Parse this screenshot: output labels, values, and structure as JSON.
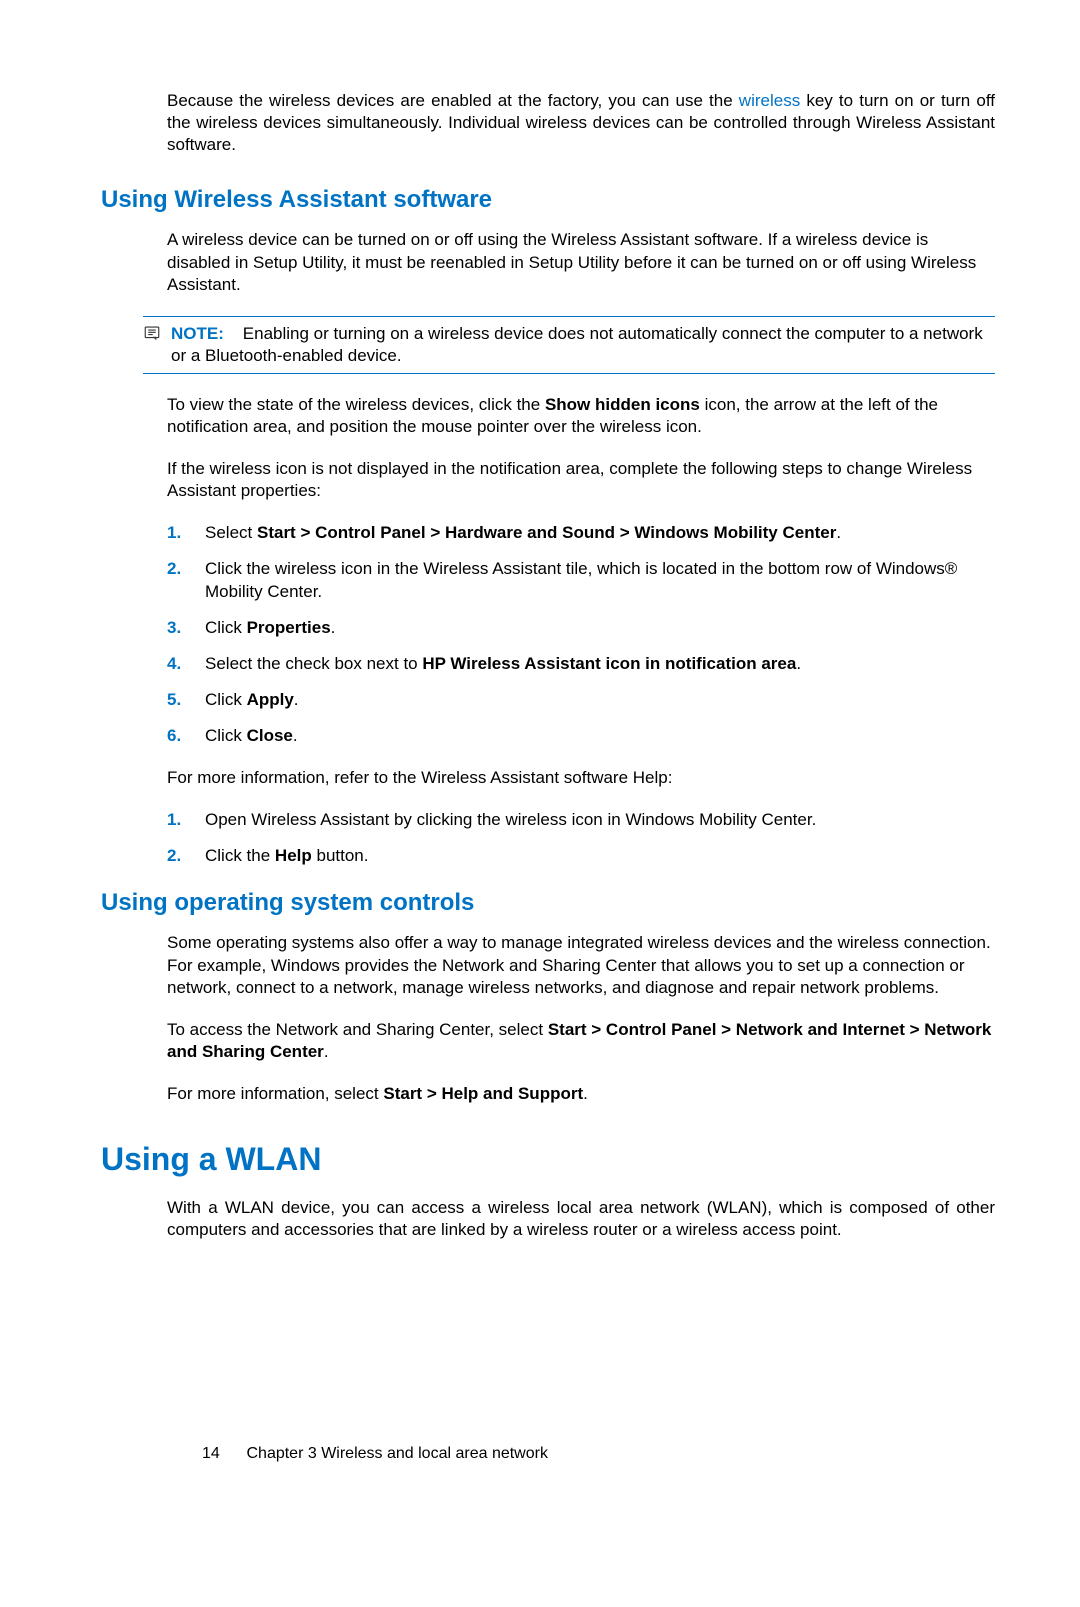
{
  "intro": {
    "prefix": "Because the wireless devices are enabled at the factory, you can use the ",
    "link": "wireless",
    "suffix": " key to turn on or turn off the wireless devices simultaneously. Individual wireless devices can be controlled through Wireless Assistant software."
  },
  "section1": {
    "heading": "Using Wireless Assistant software",
    "p1": "A wireless device can be turned on or off using the Wireless Assistant software. If a wireless device is disabled in Setup Utility, it must be reenabled in Setup Utility before it can be turned on or off using Wireless Assistant.",
    "note": {
      "label": "NOTE:",
      "text": "Enabling or turning on a wireless device does not automatically connect the computer to a network or a Bluetooth-enabled device."
    },
    "p2_pre": "To view the state of the wireless devices, click the ",
    "p2_bold": "Show hidden icons",
    "p2_post": " icon, the arrow at the left of the notification area, and position the mouse pointer over the wireless icon.",
    "p3": "If the wireless icon is not displayed in the notification area, complete the following steps to change Wireless Assistant properties:",
    "list1": {
      "i1_pre": "Select ",
      "i1_bold": "Start > Control Panel > Hardware and Sound > Windows Mobility Center",
      "i1_post": ".",
      "i2": "Click the wireless icon in the Wireless Assistant tile, which is located in the bottom row of Windows® Mobility Center.",
      "i3_pre": "Click ",
      "i3_bold": "Properties",
      "i3_post": ".",
      "i4_pre": "Select the check box next to ",
      "i4_bold": "HP Wireless Assistant icon in notification area",
      "i4_post": ".",
      "i5_pre": "Click ",
      "i5_bold": "Apply",
      "i5_post": ".",
      "i6_pre": "Click ",
      "i6_bold": "Close",
      "i6_post": "."
    },
    "p4": "For more information, refer to the Wireless Assistant software Help:",
    "list2": {
      "i1": "Open Wireless Assistant by clicking the wireless icon in Windows Mobility Center.",
      "i2_pre": "Click the ",
      "i2_bold": "Help",
      "i2_post": " button."
    }
  },
  "section2": {
    "heading": "Using operating system controls",
    "p1": "Some operating systems also offer a way to manage integrated wireless devices and the wireless connection. For example, Windows provides the Network and Sharing Center that allows you to set up a connection or network, connect to a network, manage wireless networks, and diagnose and repair network problems.",
    "p2_pre": "To access the Network and Sharing Center, select ",
    "p2_bold": "Start > Control Panel > Network and Internet > Network and Sharing Center",
    "p2_post": ".",
    "p3_pre": "For more information, select ",
    "p3_bold": "Start > Help and Support",
    "p3_post": "."
  },
  "section3": {
    "heading": "Using a WLAN",
    "p1": "With a WLAN device, you can access a wireless local area network (WLAN), which is composed of other computers and accessories that are linked by a wireless router or a wireless access point."
  },
  "footer": {
    "page_number": "14",
    "chapter_label": "Chapter 3   Wireless and local area network"
  }
}
